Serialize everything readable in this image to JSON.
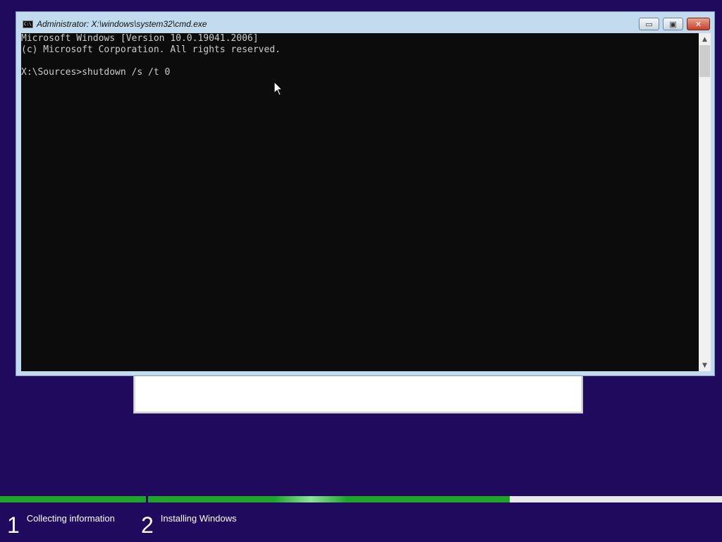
{
  "cmd": {
    "title": "Administrator: X:\\windows\\system32\\cmd.exe",
    "icon_label": "C:\\",
    "lines": [
      "Microsoft Windows [Version 10.0.19041.2006]",
      "(c) Microsoft Corporation. All rights reserved.",
      "X:\\Sources>shutdown /s /t 0"
    ],
    "buttons": {
      "minimize": "▭",
      "maximize": "▣",
      "close": "✕"
    }
  },
  "setup": {
    "steps": [
      {
        "number": "1",
        "label": "Collecting information"
      },
      {
        "number": "2",
        "label": "Installing Windows"
      }
    ]
  },
  "colors": {
    "background": "#1f0a5e",
    "progress": "#1fa52a",
    "console": "#0c0c0c",
    "console_text": "#cccccc"
  }
}
